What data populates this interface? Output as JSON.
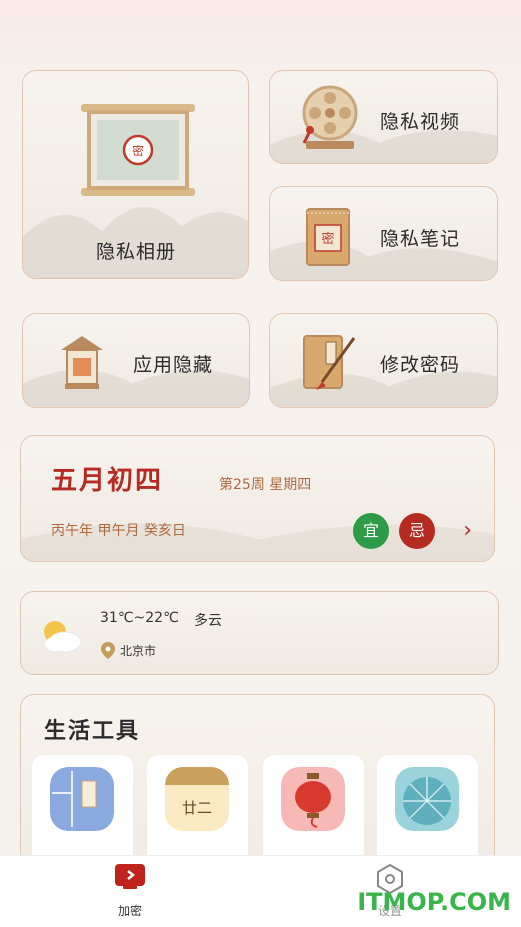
{
  "tiles": {
    "album": "隐私相册",
    "video": "隐私视频",
    "notes": "隐私笔记",
    "hide_apps": "应用隐藏",
    "change_password": "修改密码"
  },
  "calendar": {
    "lunar_date": "五月初四",
    "week_info": "第25周 星期四",
    "ganzhi": "丙午年 甲午月 癸亥日",
    "good_label": "宜",
    "bad_label": "忌",
    "arrow": "›"
  },
  "weather": {
    "temperature": "31℃~22℃",
    "condition": "多云",
    "city": "北京市"
  },
  "tools": {
    "title": "生活工具",
    "items": [
      {
        "icon": "calendar-book-icon"
      },
      {
        "icon": "lunar-day-icon",
        "text": "廿二"
      },
      {
        "icon": "lantern-icon"
      },
      {
        "icon": "umbrella-icon"
      }
    ]
  },
  "tabbar": {
    "encrypt": "加密",
    "settings": "设置"
  },
  "watermark": "ITMOP.COM",
  "colors": {
    "accent_red": "#b52a21",
    "good_green": "#2e9b48",
    "card_border": "#e2c4b0",
    "watermark_green": "#39b54a"
  }
}
